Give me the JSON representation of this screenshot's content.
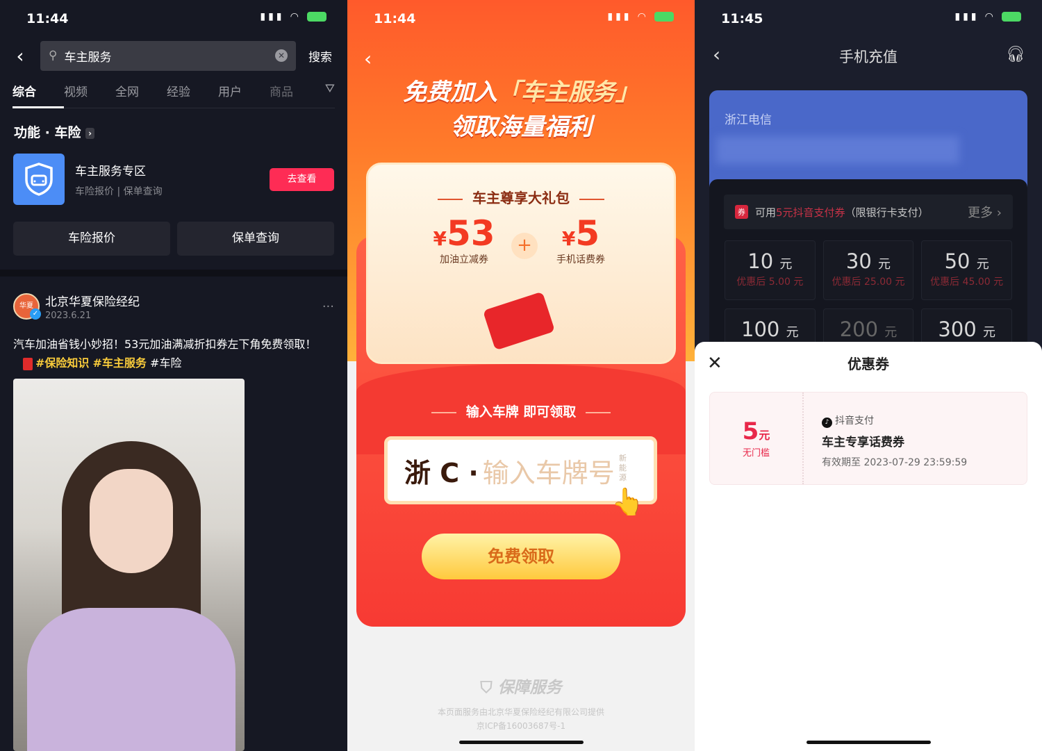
{
  "search_screen": {
    "time": "11:44",
    "query": "车主服务",
    "search_label": "搜索",
    "tabs": [
      "综合",
      "视频",
      "全网",
      "经验",
      "用户",
      "商品"
    ],
    "section_title": "功能 · 车险",
    "service": {
      "name": "车主服务专区",
      "sub": "车险报价 | 保单查询",
      "button": "去查看"
    },
    "quick_buttons": [
      "车险报价",
      "保单查询"
    ],
    "post": {
      "author": "北京华夏保险经纪",
      "avatar_text": "华夏",
      "date": "2023.6.21",
      "caption": "汽车加油省钱小妙招！53元加油满减折扣券左下角免费领取！",
      "tags": [
        "#保险知识",
        "#车主服务"
      ],
      "plain_tag": "#车险"
    }
  },
  "promo_screen": {
    "time": "11:44",
    "title_line1_pre": "免费加入",
    "title_line1_hl": "「车主服务」",
    "title_line2": "领取海量福利",
    "gift_title": "车主尊享大礼包",
    "gift_items": [
      {
        "currency": "¥",
        "value": "53",
        "label": "加油立减券"
      },
      {
        "currency": "¥",
        "value": "5",
        "label": "手机话费券"
      }
    ],
    "plus": "+",
    "enter_label": "输入车牌 即可领取",
    "plate_province": "浙 C ·",
    "plate_placeholder": "输入车牌号",
    "new_energy": "新能源",
    "claim_button": "免费领取",
    "guarantee": "保障服务",
    "footer_line1": "本页面服务由北京华夏保险经纪有限公司提供",
    "footer_line2": "京ICP备16003687号-1"
  },
  "recharge_screen": {
    "time": "11:45",
    "title": "手机充值",
    "carrier": "浙江电信",
    "coupon_badge": "券",
    "coupon_pre": "可用",
    "coupon_hl": "5元抖音支付券",
    "coupon_post": "（限银行卡支付）",
    "more": "更多 ›",
    "amounts": [
      {
        "value": "10",
        "unit": "元",
        "discount": "优惠后 5.00 元"
      },
      {
        "value": "30",
        "unit": "元",
        "discount": "优惠后 25.00 元"
      },
      {
        "value": "50",
        "unit": "元",
        "discount": "优惠后 45.00 元"
      },
      {
        "value": "100",
        "unit": "元",
        "discount": ""
      },
      {
        "value": "200",
        "unit": "元",
        "discount": ""
      },
      {
        "value": "300",
        "unit": "元",
        "discount": ""
      }
    ],
    "sheet": {
      "title": "优惠券",
      "coupon": {
        "value": "5",
        "unit": "元",
        "condition": "无门槛",
        "source": "抖音支付",
        "name": "车主专享话费券",
        "expiry": "有效期至 2023-07-29 23:59:59"
      }
    }
  },
  "colors": {
    "douyin_red": "#fe2c55",
    "promo_orange": "#ff5a2b",
    "recharge_bg": "#1b1e2c"
  }
}
